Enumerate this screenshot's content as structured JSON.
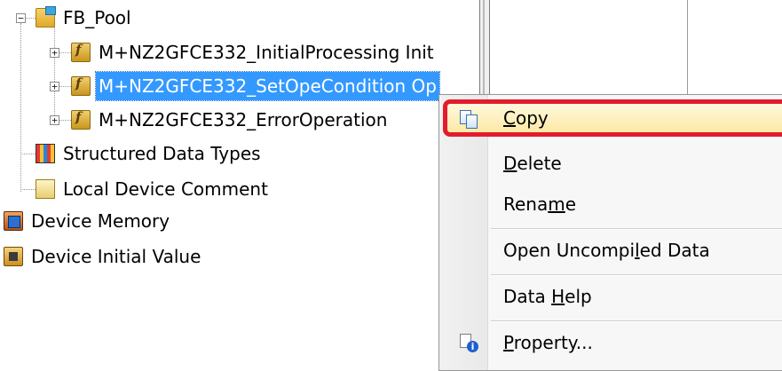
{
  "tree": {
    "fb_pool": {
      "label": "FB_Pool",
      "expander": "−"
    },
    "items": [
      {
        "label": "M+NZ2GFCE332_InitialProcessing Init",
        "expander": "+"
      },
      {
        "label": "M+NZ2GFCE332_SetOpeCondition Op",
        "expander": "+"
      },
      {
        "label": "M+NZ2GFCE332_ErrorOperation",
        "expander": "+"
      }
    ],
    "structured": {
      "label": "Structured Data Types"
    },
    "local_comment": {
      "label": "Local Device Comment"
    },
    "device_memory": {
      "label": "Device Memory"
    },
    "device_initial": {
      "label": "Device Initial Value"
    }
  },
  "context_menu": {
    "copy": {
      "pre": "",
      "key": "C",
      "post": "opy"
    },
    "delete": {
      "pre": "",
      "key": "D",
      "post": "elete"
    },
    "rename": {
      "pre": "Rena",
      "key": "m",
      "post": "e"
    },
    "open_uncompiled": {
      "pre": "Open Uncompi",
      "key": "l",
      "post": "ed Data"
    },
    "data_help": {
      "pre": "Data ",
      "key": "H",
      "post": "elp"
    },
    "property": {
      "pre": "",
      "key": "P",
      "post": "roperty..."
    }
  },
  "colors": {
    "selection": "#3399ff",
    "highlight_border": "#e41b2d"
  },
  "icons": {
    "fb_pool": "fb-pool-folder-icon",
    "fb_item": "function-block-icon",
    "structured": "structured-data-icon",
    "comment": "device-comment-icon",
    "memory": "device-memory-icon",
    "initial": "device-initial-value-icon",
    "copy": "copy-icon",
    "property": "property-icon"
  }
}
